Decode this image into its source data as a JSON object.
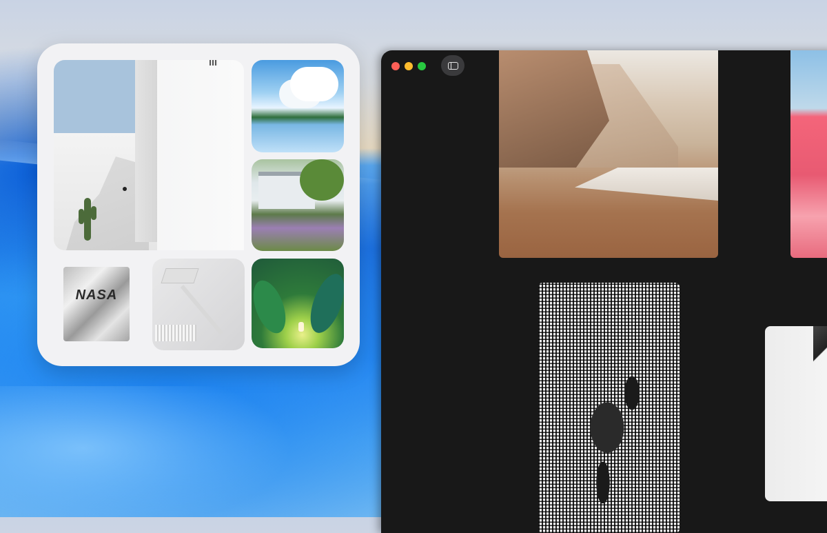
{
  "desktop": {
    "wallpaper": "blue-gradient-wallpaper"
  },
  "widget": {
    "name": "photo-collage-widget",
    "tiles": [
      {
        "id": "white-wall-cactus",
        "description": "white-wall-cactus-photo"
      },
      {
        "id": "lake-clouds",
        "description": "lake-clouds-illustration"
      },
      {
        "id": "cottage-garden",
        "description": "cottage-garden-photo"
      },
      {
        "id": "forest-child",
        "description": "forest-child-illustration"
      },
      {
        "id": "nasa-bag",
        "description": "nasa-foil-bag-photo",
        "logo_text": "NASA"
      },
      {
        "id": "desk-lamp",
        "description": "desk-lamp-photo"
      }
    ]
  },
  "window": {
    "traffic_lights": {
      "close_color": "#fe5f57",
      "minimize_color": "#febc2e",
      "maximize_color": "#28c840"
    },
    "toolbar": {
      "sidebar_toggle_icon": "sidebar-icon"
    },
    "gallery": [
      {
        "id": "misty-beach-cliffs"
      },
      {
        "id": "pink-dunes"
      },
      {
        "id": "grid-silhouette-figure"
      },
      {
        "id": "white-object-partial"
      }
    ]
  }
}
